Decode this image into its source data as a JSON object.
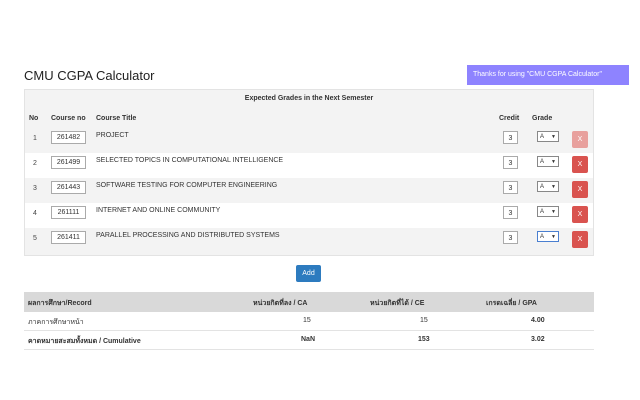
{
  "toast": "Thanks for using \"CMU CGPA Calculator\"",
  "title": "CMU CGPA Calculator",
  "card_heading": "Expected Grades in the Next Semester",
  "columns": {
    "no": "No",
    "course_no": "Course no",
    "course_title": "Course Title",
    "credit": "Credit",
    "grade": "Grade"
  },
  "courses": [
    {
      "no": "1",
      "course_no": "261482",
      "title": "PROJECT",
      "credit": "3",
      "grade": "A"
    },
    {
      "no": "2",
      "course_no": "261499",
      "title": "SELECTED TOPICS IN COMPUTATIONAL INTELLIGENCE",
      "credit": "3",
      "grade": "A"
    },
    {
      "no": "3",
      "course_no": "261443",
      "title": "SOFTWARE TESTING FOR COMPUTER ENGINEERING",
      "credit": "3",
      "grade": "A"
    },
    {
      "no": "4",
      "course_no": "261111",
      "title": "INTERNET AND ONLINE COMMUNITY",
      "credit": "3",
      "grade": "A"
    },
    {
      "no": "5",
      "course_no": "261411",
      "title": "PARALLEL PROCESSING AND DISTRIBUTED SYSTEMS",
      "credit": "3",
      "grade": "A"
    }
  ],
  "delete_label": "X",
  "add_label": "Add",
  "record": {
    "headers": [
      "ผลการศึกษา/Record",
      "หน่วยกิตที่ลง / CA",
      "หน่วยกิตที่ได้ / CE",
      "เกรดเฉลี่ย / GPA"
    ],
    "rows": [
      {
        "label": "ภาคการศึกษาหน้า",
        "ca": "15",
        "ce": "15",
        "gpa": "4.00"
      },
      {
        "label": "คาดหมายสะสมทั้งหมด / Cumulative",
        "ca": "NaN",
        "ce": "153",
        "gpa": "3.02"
      }
    ]
  }
}
